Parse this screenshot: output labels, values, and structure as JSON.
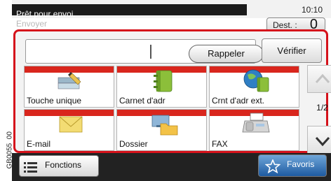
{
  "status": {
    "message": "Prêt pour envoi.",
    "time": "10:10"
  },
  "header": {
    "subtitle": "Envoyer",
    "dest_label": "Dest. :",
    "dest_count": "0"
  },
  "destination": {
    "input_value": "",
    "recall_label": "Rappeler",
    "verify_label": "Vérifier"
  },
  "tiles": [
    {
      "label": "Touche unique",
      "icon": "one-touch-key-icon"
    },
    {
      "label": "Carnet d'adr",
      "icon": "address-book-icon"
    },
    {
      "label": "Crnt d'adr ext.",
      "icon": "external-address-book-icon"
    },
    {
      "label": "E-mail",
      "icon": "email-icon"
    },
    {
      "label": "Dossier",
      "icon": "folder-icon"
    },
    {
      "label": "FAX",
      "icon": "fax-icon"
    }
  ],
  "pager": {
    "label": "1/2"
  },
  "footer": {
    "functions_label": "Fonctions",
    "favorites_label": "Favoris"
  },
  "side_code": "GB0055_00",
  "colors": {
    "accent_red": "#d5121b",
    "bar_dark": "#222222",
    "favorites_blue": "#2e6db4"
  }
}
